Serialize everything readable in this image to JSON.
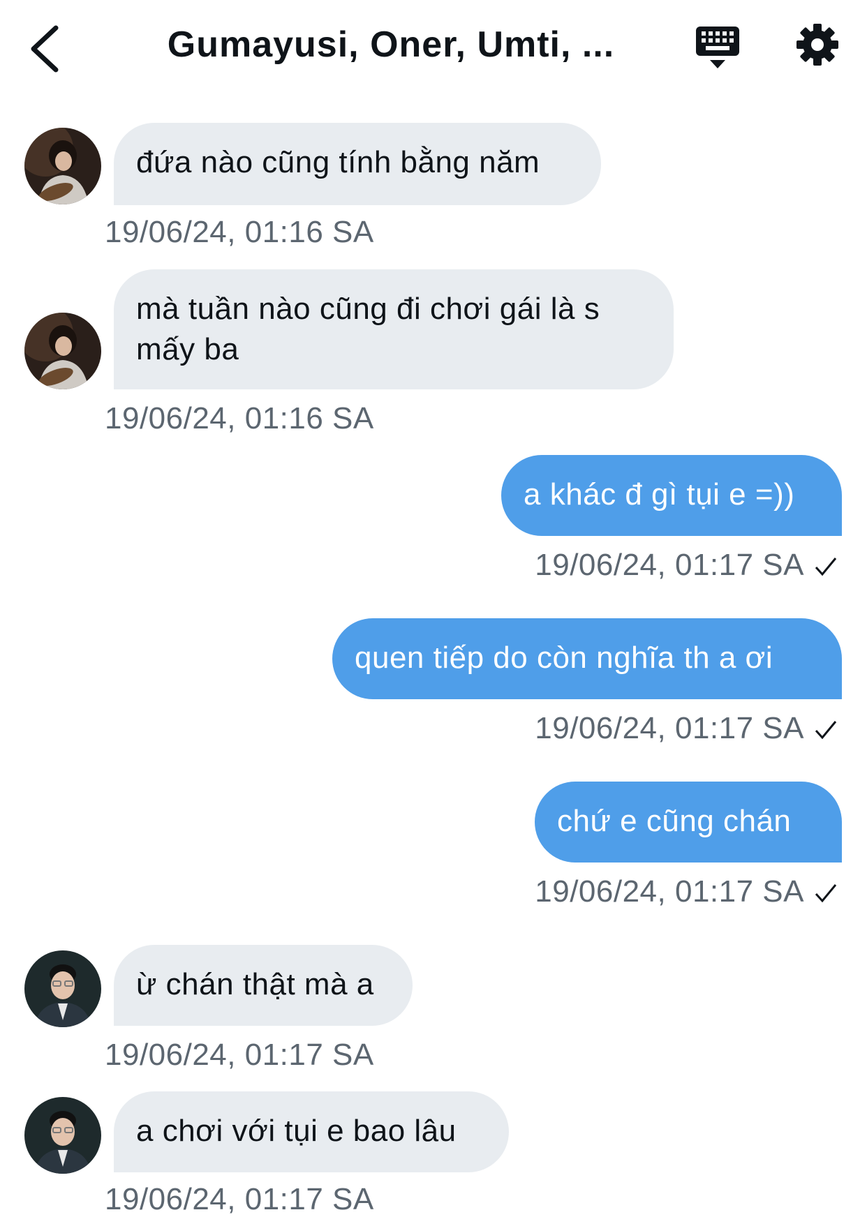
{
  "header": {
    "title": "Gumayusi, Oner, Umti, ...",
    "icons": {
      "back": "chevron-left-icon",
      "keyboard": "keyboard-icon",
      "settings": "gear-icon"
    }
  },
  "messages": [
    {
      "side": "incoming",
      "avatar": "avatar-guitar-player",
      "text": "đứa nào cũng tính bằng năm",
      "time": "19/06/24, 01:16 SA"
    },
    {
      "side": "incoming",
      "avatar": "avatar-guitar-player",
      "text": "mà tuần nào cũng đi chơi gái là s mấy ba",
      "time": "19/06/24, 01:16 SA"
    },
    {
      "side": "outgoing",
      "text": "a khác đ gì tụi e =))",
      "time": "19/06/24, 01:17 SA",
      "read": true
    },
    {
      "side": "outgoing",
      "text": "quen tiếp do còn nghĩa th a ơi",
      "time": "19/06/24, 01:17 SA",
      "read": true
    },
    {
      "side": "outgoing",
      "text": "chứ e cũng chán",
      "time": "19/06/24, 01:17 SA",
      "read": true
    },
    {
      "side": "incoming",
      "avatar": "avatar-man-glasses",
      "text": "ừ chán thật mà a",
      "time": "19/06/24, 01:17 SA"
    },
    {
      "side": "incoming",
      "avatar": "avatar-man-glasses",
      "text": "a chơi với tụi e bao lâu",
      "time": "19/06/24, 01:17 SA"
    }
  ],
  "colors": {
    "outgoing_bubble": "#4f9ee9",
    "incoming_bubble": "#e8ecf0",
    "timestamp": "#5c6670"
  }
}
